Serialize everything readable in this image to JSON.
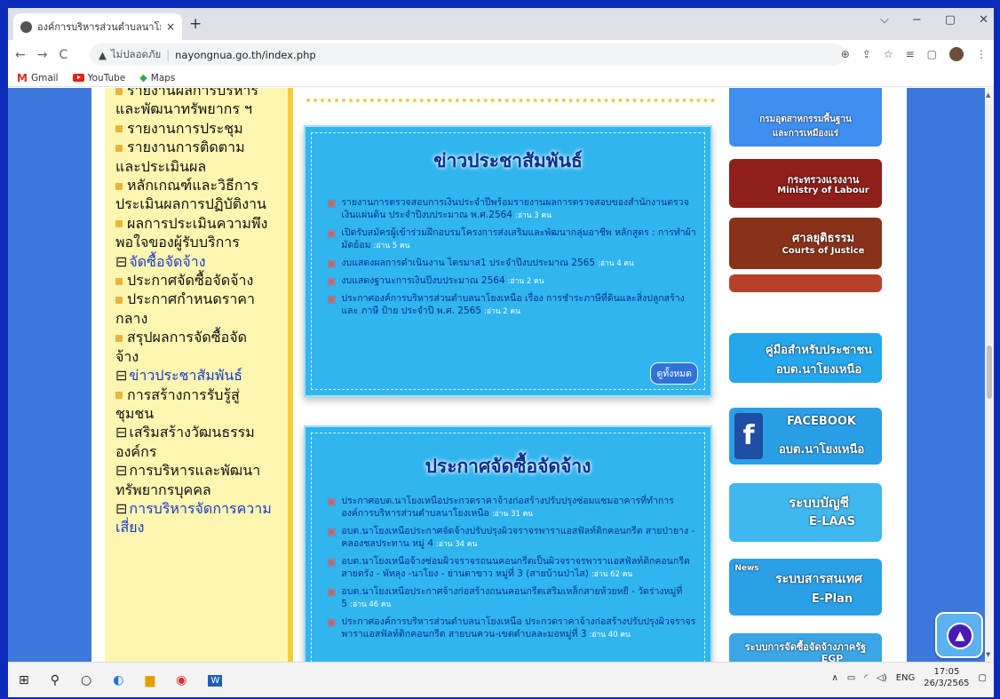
{
  "browser": {
    "tab_title": "องค์การบริหารส่วนตำบลนาโยงเหนือ",
    "tab_close": "×",
    "new_tab": "+",
    "window_controls": [
      "⌵",
      "−",
      "▢",
      "✕"
    ],
    "nav": {
      "back": "←",
      "forward": "→",
      "reload": "C"
    },
    "insecure_label": "ไม่ปลอดภัย",
    "url_separator": "|",
    "url": "nayongnua.go.th/index.php",
    "bookmarks": [
      {
        "label": "Gmail",
        "icon": "gmail-icon"
      },
      {
        "label": "YouTube",
        "icon": "youtube-icon"
      },
      {
        "label": "Maps",
        "icon": "maps-icon"
      }
    ]
  },
  "sidebar": {
    "lines": [
      {
        "text": "รายงานผลการบริหาร",
        "bullet": true,
        "link": false,
        "cut": true
      },
      {
        "text": "และพัฒนาทรัพยากร ฯ",
        "bullet": false,
        "link": false
      },
      {
        "text": "รายงานการประชุม",
        "bullet": true,
        "link": false
      },
      {
        "text": "รายงานการติดตาม",
        "bullet": true,
        "link": false
      },
      {
        "text": "และประเมินผล",
        "bullet": false,
        "link": false
      },
      {
        "text": "หลักเกณฑ์และวิธีการ",
        "bullet": true,
        "link": false
      },
      {
        "text": "ประเมินผลการปฏิบัติงาน",
        "bullet": false,
        "link": false
      },
      {
        "text": "ผลการประเมินความพึง",
        "bullet": true,
        "link": false
      },
      {
        "text": "พอใจของผู้รับบริการ",
        "bullet": false,
        "link": false
      },
      {
        "text": "จัดซื้อจัดจ้าง",
        "folder": true,
        "link": true
      },
      {
        "text": "ประกาศจัดซื้อจัดจ้าง",
        "bullet": true,
        "link": false
      },
      {
        "text": "ประกาศกำหนดราคา",
        "bullet": true,
        "link": false
      },
      {
        "text": "กลาง",
        "bullet": false,
        "link": false
      },
      {
        "text": "สรุปผลการจัดซื้อจัด",
        "bullet": true,
        "link": false
      },
      {
        "text": "จ้าง",
        "bullet": false,
        "link": false
      },
      {
        "text": "ข่าวประชาสัมพันธ์",
        "folder": true,
        "link": true
      },
      {
        "text": "การสร้างการรับรู้สู่",
        "bullet": true,
        "link": false
      },
      {
        "text": "ชุมชน",
        "bullet": false,
        "link": false
      },
      {
        "text": "เสริมสร้างวัฒนธรรม",
        "folder": true,
        "link": false
      },
      {
        "text": "องค์กร",
        "bullet": false,
        "link": false
      },
      {
        "text": "การบริหารและพัฒนา",
        "folder": true,
        "link": false
      },
      {
        "text": "ทรัพยากรบุคคล",
        "bullet": false,
        "link": false
      },
      {
        "text": "การบริหารจัดการความ",
        "folder": true,
        "link": true
      },
      {
        "text": "เสี่ยง",
        "bullet": false,
        "link": true
      }
    ]
  },
  "news": {
    "title": "ข่าวประชาสัมพันธ์",
    "items": [
      {
        "text": "รายงานการตรวจสอบการเงินประจำปีพร้อมรายงานผลการตรวจสอบของสำนักงานตรวจเงินแผ่นดิน ประจำปีงบประมาณ พ.ศ.2564",
        "count": ":อ่าน 3 คน"
      },
      {
        "text": "เปิดรับสมัครผู้เข้าร่วมฝึกอบรมโครงการส่งเสริมและพัฒนากลุ่มอาชีพ หลักสูตร : การทำผ้ามัดย้อม",
        "count": ":อ่าน 5 คน"
      },
      {
        "text": "งบแสดงผลการดำเนินงาน ไตรมาส1 ประจำปีงบประมาณ 2565",
        "count": ":อ่าน 4 คน"
      },
      {
        "text": "งบแสดงฐานะการเงินปีงบประมาณ 2564",
        "count": ":อ่าน 2 คน"
      },
      {
        "text": "ประกาศองค์การบริหารส่วนตำบลนาโยงเหนือ เรื่อง การชำระภาษีที่ดินและสิ่งปลูกสร้าง และ ภาษี ป้าย ประจำปี พ.ศ. 2565",
        "count": ":อ่าน 2 คน"
      }
    ],
    "see_all": "ดูทั้งหมด"
  },
  "procurement": {
    "title": "ประกาศจัดซื้อจัดจ้าง",
    "items": [
      {
        "text": "ประกาศอบต.นาโยงเหนือประกวดราคาจ้างก่อสร้างปรับปรุงซ่อมแซมอาคารที่ทำการองค์การบริหารส่วนตำบลนาโยงเหนือ",
        "count": ":อ่าน 31 คน"
      },
      {
        "text": "อบต.นาโยงเหนือประกาศจัดจ้างปรับปรุงผิวจราจรพาราแอสฟัลท์ติกคอนกรีต สายป่ายาง - คลองชลประทาน หมู่ 4",
        "count": ":อ่าน 34 คน"
      },
      {
        "text": "อบต.นาโยงเหนือจ้างซ่อมผิวจราจรถนนคอนกรีตเป็นผิวจราจรพาราแอสฟัลท์ติกคอนกรีต สายตรัง - พัทลุง -นาโยง - ย่านตาขาว หมู่ที่ 3 (สายบ้านป่าไส)",
        "count": ":อ่าน 62 คน"
      },
      {
        "text": "อบต.นาโยงเหนือประกาศจ้างก่อสร้างถนนคอนกรีตเสริมเหล็กสายห้วยหยี - วัดร่างหมู่ที่ 5",
        "count": ":อ่าน 46 คน"
      },
      {
        "text": "ประกาศองค์การบริหารส่วนตำบลนาโยงเหนือ ประกวดราคาจ้างก่อสร้างปรับปรุงผิวจราจรพาราแอสฟัลท์ติกคอนกรีต สายบนควน-เขตตำบลละมอหมู่ที่ 3",
        "count": ":อ่าน 40 คน"
      }
    ]
  },
  "right_links": {
    "dbd_line1": "กรมอุตสาหกรรมพื้นฐาน",
    "dbd_line2": "และการเหมืองแร่",
    "labour_th": "กระทรวงแรงงาน",
    "labour_en": "Ministry of Labour",
    "justice_th": "ศาลยุติธรรม",
    "justice_en": "Courts of Justice",
    "manual_line1": "คู่มือสำหรับประชาชน",
    "manual_line2": "อบต.นาโยงเหนือ",
    "fb_line1": "FACEBOOK",
    "fb_line2": "อบต.นาโยงเหนือ",
    "fb_letter": "f",
    "laas_line1": "ระบบบัญชี",
    "laas_line2": "E-LAAS",
    "eplan_news": "News",
    "eplan_line1": "ระบบสารสนเทศ",
    "eplan_line2": "E-Plan",
    "egp_line1": "ระบบการจัดซื้อจัดจ้างภาครัฐ",
    "egp_line2": "EGP"
  },
  "taskbar": {
    "lang": "ENG",
    "time": "17:05",
    "date": "26/3/2565"
  }
}
